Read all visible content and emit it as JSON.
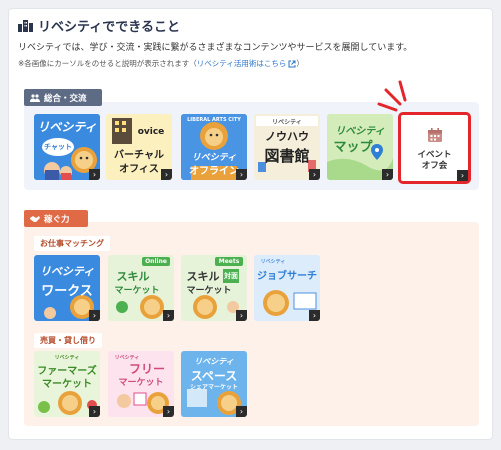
{
  "header": {
    "title": "リベシティでできること",
    "description": "リベシティでは、学び・交流・実践に繋がるさまざまなコンテンツやサービスを展開しています。",
    "note_prefix": "※各画像にカーソルをのせると説明が表示されます（",
    "note_link": "リベシティ活用術はこちら",
    "note_suffix": "）"
  },
  "sections": {
    "community": {
      "label": "総合・交流",
      "tiles": [
        {
          "text1": "リベシティ",
          "text2": "チャット"
        },
        {
          "text1": "ovice",
          "text2": "バーチャル",
          "text3": "オフィス"
        },
        {
          "text1": "LIBERAL ARTS CITY",
          "text2": "リベシティ",
          "text3": "オフライン"
        },
        {
          "text1": "リベシティ",
          "text2": "ノウハウ",
          "text3": "図書館"
        },
        {
          "text1": "リベシティ",
          "text2": "マップ"
        },
        {
          "text1": "イベント",
          "text2": "オフ会"
        }
      ]
    },
    "earn": {
      "label": "稼ぐ力",
      "sub1": "お仕事マッチング",
      "sub1_tiles": [
        {
          "text1": "リベシティ",
          "text2": "ワークス"
        },
        {
          "text1": "Online",
          "text2": "スキル",
          "text3": "マーケット"
        },
        {
          "text1": "Meets",
          "text2": "スキル",
          "text3": "マーケット",
          "text4": "対面"
        },
        {
          "text1": "リベシティ",
          "text2": "ジョブサーチ"
        }
      ],
      "sub2": "売買・貸し借り",
      "sub2_tiles": [
        {
          "text1": "リベシティ",
          "text2": "ファーマーズ",
          "text3": "マーケット"
        },
        {
          "text1": "リベシティ",
          "text2": "フリー",
          "text3": "マーケット"
        },
        {
          "text1": "リベシティ",
          "text2": "スペース",
          "text3": "シェアマーケット"
        }
      ]
    }
  },
  "colors": {
    "accent_red": "#e2262c",
    "community_tab": "#5d6b85",
    "earn_tab": "#e06a45",
    "link": "#2a72c8"
  }
}
